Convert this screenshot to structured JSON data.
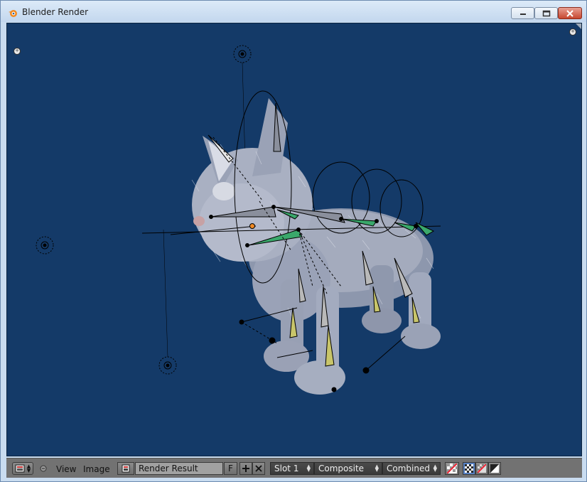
{
  "window": {
    "title": "Blender Render",
    "accent_color": "#f08a24"
  },
  "viewport": {
    "background_color": "#143a68"
  },
  "header": {
    "view_menu": "View",
    "image_menu": "Image",
    "image_name": "Render Result",
    "fake_user_label": "F",
    "slot": "Slot 1",
    "layer": "Composite",
    "pass": "Combined"
  }
}
